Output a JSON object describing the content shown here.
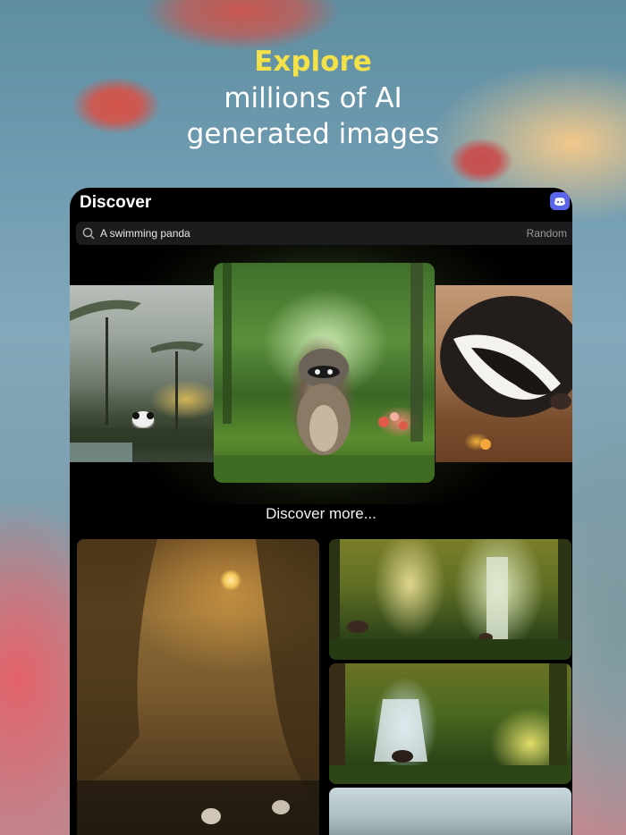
{
  "hero": {
    "title": "Explore",
    "line1": "millions of AI",
    "line2": "generated images"
  },
  "app": {
    "page_title": "Discover",
    "discord_icon": "discord-icon",
    "search": {
      "placeholder": "A swimming panda",
      "value": "A swimming panda",
      "random_label": "Random"
    },
    "carousel": {
      "images": [
        "panda-landscape-image",
        "raccoon-forest-image",
        "badger-portrait-image"
      ]
    },
    "discover_more_label": "Discover more...",
    "grid": {
      "images": [
        "canyon-sunset-image",
        "forest-waterfall-image",
        "bear-waterfall-image",
        "misty-landscape-image"
      ]
    }
  },
  "colors": {
    "accent_yellow": "#f3e14a",
    "discord_blue": "#5a65ea",
    "app_background": "#000000"
  }
}
